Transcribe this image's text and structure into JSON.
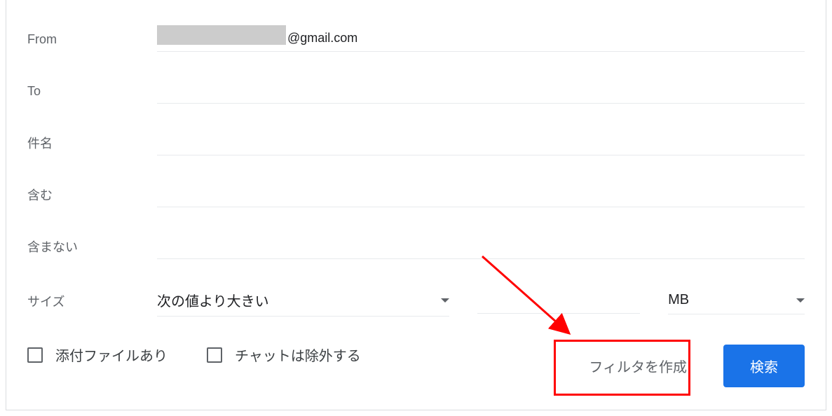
{
  "fields": {
    "from": {
      "label": "From",
      "value": "@gmail.com"
    },
    "to": {
      "label": "To",
      "value": ""
    },
    "subject": {
      "label": "件名",
      "value": ""
    },
    "includes": {
      "label": "含む",
      "value": ""
    },
    "excludes": {
      "label": "含まない",
      "value": ""
    },
    "size": {
      "label": "サイズ",
      "operator": "次の値より大きい",
      "value": "",
      "unit": "MB"
    }
  },
  "checkboxes": {
    "has_attachment": {
      "label": "添付ファイルあり",
      "checked": false
    },
    "exclude_chats": {
      "label": "チャットは除外する",
      "checked": false
    }
  },
  "buttons": {
    "create_filter": "フィルタを作成",
    "search": "検索"
  }
}
